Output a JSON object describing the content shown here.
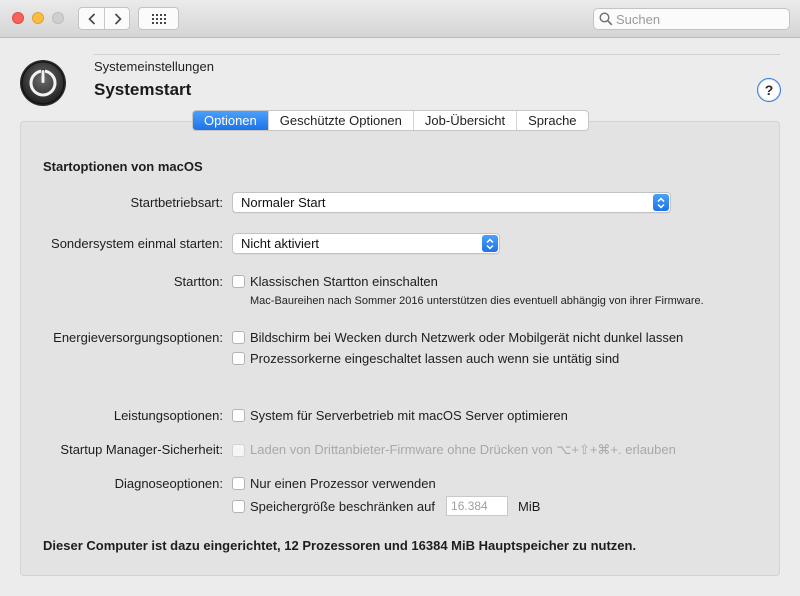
{
  "toolbar": {
    "search_placeholder": "Suchen"
  },
  "header": {
    "breadcrumb": "Systemeinstellungen",
    "title": "Systemstart",
    "help_label": "?"
  },
  "tabs": [
    {
      "label": "Optionen",
      "active": true
    },
    {
      "label": "Geschützte Optionen",
      "active": false
    },
    {
      "label": "Job-Übersicht",
      "active": false
    },
    {
      "label": "Sprache",
      "active": false
    }
  ],
  "main": {
    "section_title": "Startoptionen von macOS",
    "startmode": {
      "label": "Startbetriebsart:",
      "value": "Normaler Start"
    },
    "special_boot": {
      "label": "Sondersystem einmal starten:",
      "value": "Nicht aktiviert"
    },
    "chime": {
      "label": "Startton:",
      "option": "Klassischen Startton einschalten",
      "note": "Mac-Baureihen nach Sommer 2016 unterstützen dies eventuell abhängig von ihrer Firmware."
    },
    "energy": {
      "label": "Energieversorgungsoptionen:",
      "option1": "Bildschirm bei Wecken durch Netzwerk oder Mobilgerät nicht dunkel lassen",
      "option2": "Prozessorkerne eingeschaltet lassen auch wenn sie untätig sind"
    },
    "performance": {
      "label": "Leistungsoptionen:",
      "option": "System für Serverbetrieb mit macOS Server optimieren"
    },
    "startup_security": {
      "label": "Startup Manager-Sicherheit:",
      "option": "Laden von Drittanbieter-Firmware ohne Drücken von ⌥+⇧+⌘+. erlauben"
    },
    "diagnostics": {
      "label": "Diagnoseoptionen:",
      "option1": "Nur einen Prozessor verwenden",
      "option2": "Speichergröße beschränken auf",
      "memory_value": "16.384",
      "memory_unit": "MiB"
    },
    "footer": "Dieser Computer ist dazu eingerichtet, 12 Prozessoren und 16384 MiB Hauptspeicher zu nutzen."
  },
  "colors": {
    "accent": "#1e73e8",
    "close": "#fc605b",
    "minimize": "#fdbc40"
  }
}
